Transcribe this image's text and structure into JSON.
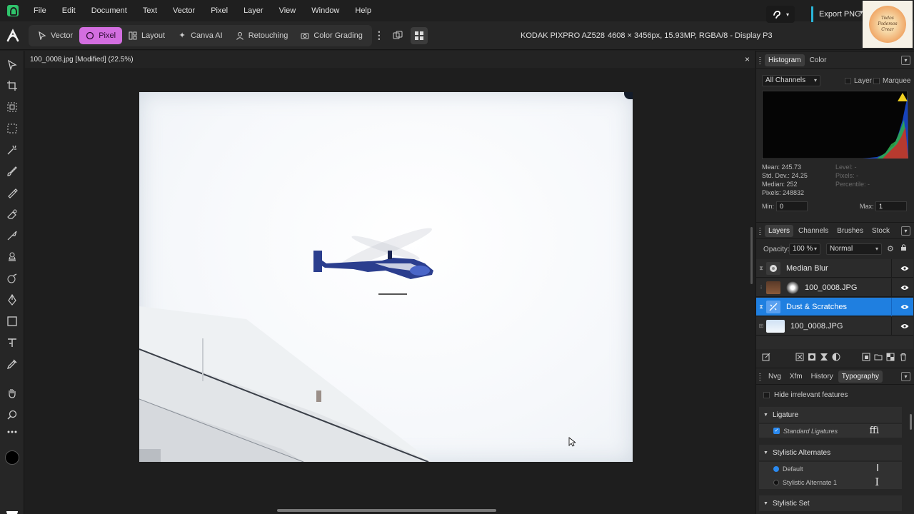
{
  "menu": [
    "File",
    "Edit",
    "Document",
    "Text",
    "Vector",
    "Pixel",
    "Layer",
    "View",
    "Window",
    "Help"
  ],
  "toolbar": {
    "personas": [
      {
        "label": "Vector",
        "icon": "vector-persona-icon"
      },
      {
        "label": "Pixel",
        "icon": "pixel-persona-icon",
        "active": true
      },
      {
        "label": "Layout",
        "icon": "layout-persona-icon"
      },
      {
        "label": "Canva AI",
        "icon": "sparkle-icon"
      },
      {
        "label": "Retouching",
        "icon": "person-icon"
      },
      {
        "label": "Color Grading",
        "icon": "camera-icon"
      }
    ],
    "camera_model": "KODAK PIXPRO AZ528",
    "image_info": "4608 × 3456px, 15.93MP, RGBA/8 - Display P3",
    "export_label": "Export PNG",
    "accent_color": "#d36ee0",
    "channel_logo_text": "Todos Podemos Crear"
  },
  "document": {
    "tab_title": "100_0008.jpg [Modified] (22.5%)",
    "close_glyph": "×"
  },
  "histogram": {
    "tabs": [
      "Histogram",
      "Color"
    ],
    "channel": "All Channels",
    "layer_label": "Layer",
    "marquee_label": "Marquee",
    "mean": "Mean: 245.73",
    "std_dev": "Std. Dev.: 24.25",
    "median": "Median: 252",
    "pixels": "Pixels: 248832",
    "level": "Level: -",
    "pixels_sel": "Pixels: -",
    "percentile": "Percentile: -",
    "min_label": "Min:",
    "min_value": "0",
    "max_label": "Max:",
    "max_value": "1"
  },
  "layers": {
    "tabs": [
      "Layers",
      "Channels",
      "Brushes",
      "Stock"
    ],
    "opacity_label": "Opacity:",
    "opacity_value": "100 %",
    "blend_mode": "Normal",
    "items": [
      {
        "name": "Median Blur",
        "type": "filter"
      },
      {
        "name": "100_0008.JPG",
        "type": "image-child"
      },
      {
        "name": "Dust & Scratches",
        "type": "filter",
        "selected": true
      },
      {
        "name": "100_0008.JPG",
        "type": "image"
      }
    ],
    "selected_color": "#1f7fe0"
  },
  "typography": {
    "tabs": [
      "Nvg",
      "Xfm",
      "History",
      "Typography"
    ],
    "hide_irrelevant": "Hide irrelevant features",
    "sections": [
      {
        "title": "Ligature",
        "options": [
          {
            "label": "Standard Ligatures",
            "checked": true,
            "glyph": "ffi"
          }
        ]
      },
      {
        "title": "Stylistic Alternates",
        "options": [
          {
            "label": "Default",
            "selected": true,
            "glyph": "I"
          },
          {
            "label": "Stylistic Alternate 1",
            "selected": false,
            "glyph": "I"
          }
        ]
      },
      {
        "title": "Stylistic Set"
      }
    ]
  }
}
